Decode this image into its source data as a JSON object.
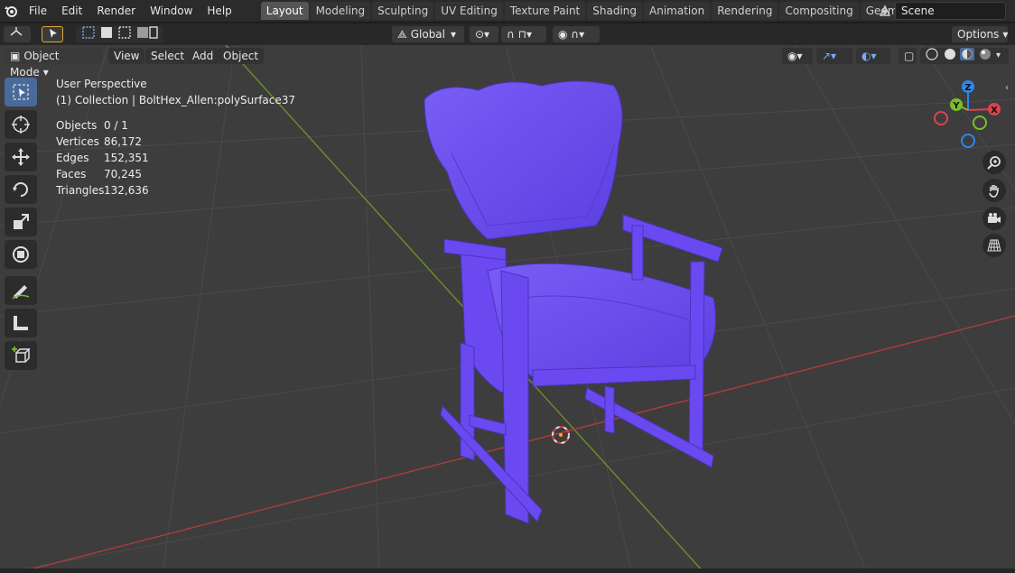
{
  "menu": [
    "File",
    "Edit",
    "Render",
    "Window",
    "Help"
  ],
  "workspaces": [
    "Layout",
    "Modeling",
    "Sculpting",
    "UV Editing",
    "Texture Paint",
    "Shading",
    "Animation",
    "Rendering",
    "Compositing",
    "Geometry Nod"
  ],
  "active_workspace": "Layout",
  "scene": "Scene",
  "transform_orientation": "Global",
  "options_label": "Options",
  "mode": "Object Mode",
  "header_menus": [
    "View",
    "Select",
    "Add",
    "Object"
  ],
  "viewport_info": {
    "perspective": "User Perspective",
    "collection": "(1) Collection | BoltHex_Allen:polySurface37"
  },
  "stats": [
    {
      "label": "Objects",
      "value": "0 / 1"
    },
    {
      "label": "Vertices",
      "value": "86,172"
    },
    {
      "label": "Edges",
      "value": "152,351"
    },
    {
      "label": "Faces",
      "value": "70,245"
    },
    {
      "label": "Triangles",
      "value": "132,636"
    }
  ],
  "gizmo": {
    "z": "Z",
    "y": "Y",
    "x": "X"
  },
  "colors": {
    "accent": "#4a6a9a",
    "object": "#6a4af0",
    "axis_x": "#e0424d",
    "axis_y": "#7ebc2a",
    "axis_z": "#2f86ea"
  }
}
